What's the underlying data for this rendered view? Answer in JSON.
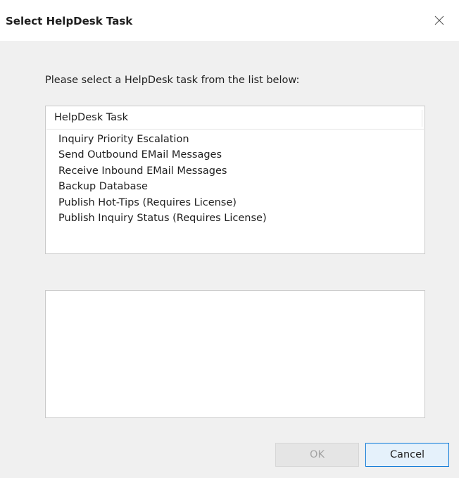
{
  "window": {
    "title": "Select HelpDesk Task"
  },
  "instruction": "Please select a HelpDesk task from the list below:",
  "task_list": {
    "column_header": "HelpDesk Task",
    "items": [
      "Inquiry Priority Escalation",
      "Send Outbound EMail Messages",
      "Receive Inbound EMail Messages",
      "Backup Database",
      "Publish Hot-Tips (Requires License)",
      "Publish Inquiry Status (Requires License)"
    ]
  },
  "description": "",
  "buttons": {
    "ok_label": "OK",
    "ok_enabled": false,
    "cancel_label": "Cancel"
  },
  "icons": {
    "close": "close-icon"
  },
  "colors": {
    "titlebar_bg": "#ffffff",
    "dialog_bg": "#f0f0f0",
    "focus_border": "#0a78d7",
    "disabled_text": "#a3a3a3"
  }
}
